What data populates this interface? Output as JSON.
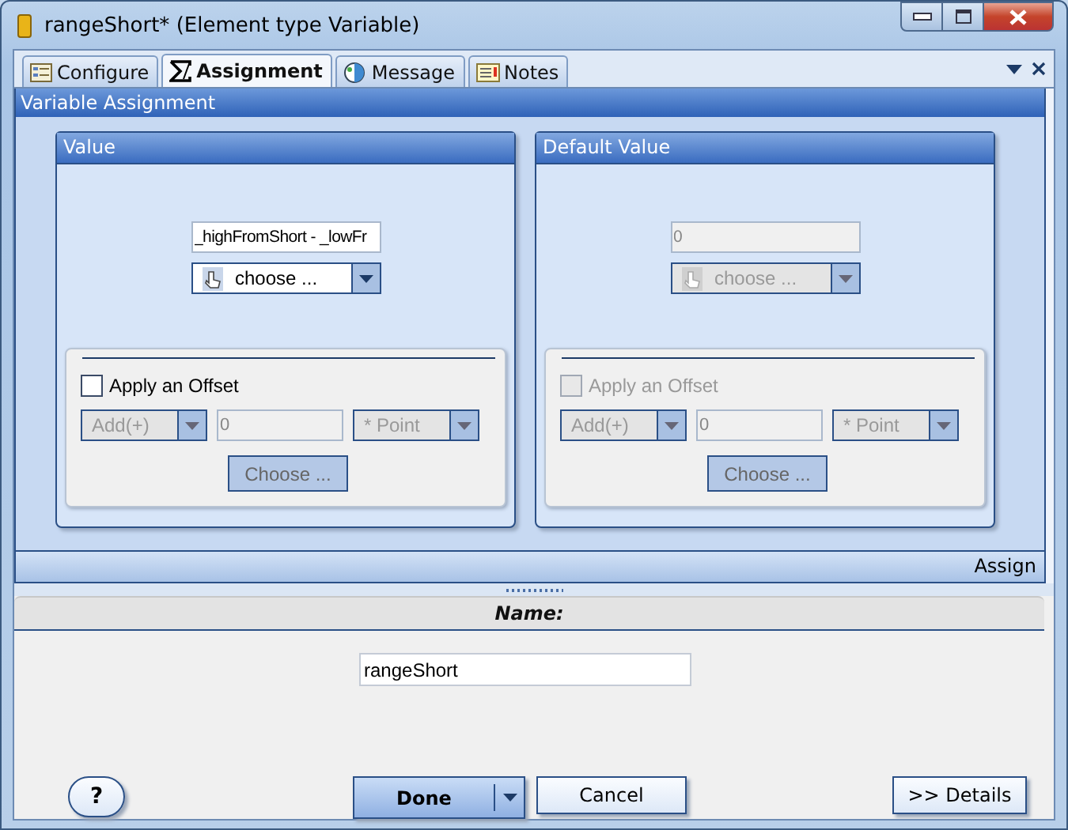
{
  "window": {
    "title": "rangeShort* (Element type Variable)"
  },
  "tabs": [
    {
      "label": "Configure",
      "selected": false
    },
    {
      "label": "Assignment",
      "selected": true
    },
    {
      "label": "Message",
      "selected": false
    },
    {
      "label": "Notes",
      "selected": false
    }
  ],
  "panel": {
    "title": "Variable Assignment",
    "footer": "Assign"
  },
  "groups": [
    {
      "title": "Value",
      "value": "_highFromShort - _lowFr",
      "disabled": false,
      "choose": "choose ...",
      "offset": {
        "label": "Apply an Offset",
        "checked": false,
        "operator": "Add(+)",
        "amount": "0",
        "unit": "* Point",
        "button": "Choose ..."
      }
    },
    {
      "title": "Default Value",
      "value": "0",
      "disabled": true,
      "choose": "choose ...",
      "offset": {
        "label": "Apply an Offset",
        "checked": false,
        "operator": "Add(+)",
        "amount": "0",
        "unit": "* Point",
        "button": "Choose ..."
      }
    }
  ],
  "name_section": {
    "label": "Name:",
    "value": "rangeShort"
  },
  "buttons": {
    "help": "?",
    "done": "Done",
    "cancel": "Cancel",
    "details": ">> Details"
  }
}
